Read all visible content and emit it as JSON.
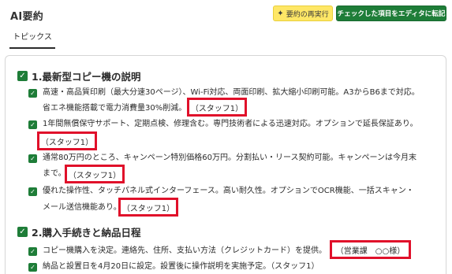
{
  "app": {
    "title": "AI要約"
  },
  "toolbar": {
    "rerun_label": "要約の再実行",
    "transfer_label": "チェックした項目をエディタに転記"
  },
  "tabs": [
    {
      "label": "トピックス"
    }
  ],
  "sections": [
    {
      "title": "1.最新型コピー機の説明",
      "items": [
        {
          "line1": "高速・高品質印刷（最大分速30ページ）、Wi-Fi対応、両面印刷、拡大縮小印刷可能。A3からB6まで対応。",
          "line2": "省エネ機能搭載で電力消費量30%削減。",
          "tag": "（スタッフ1）"
        },
        {
          "line1": "1年間無償保守サポート、定期点検、修理含む。専門技術者による迅速対応。オプションで延長保証あり。",
          "line2": "",
          "tag": "（スタッフ1）"
        },
        {
          "line1": "通常80万円のところ、キャンペーン特別価格60万円。分割払い・リース契約可能。キャンペーンは今月末",
          "line2": "まで。",
          "tag": "（スタッフ1）"
        },
        {
          "line1": "優れた操作性、タッチパネル式インターフェース。高い耐久性。オプションでOCR機能、一括スキャン・",
          "line2": "メール送信機能あり。",
          "tag": "（スタッフ1）"
        }
      ]
    },
    {
      "title": "2.購入手続きと納品日程",
      "items": [
        {
          "line1": "コピー機購入を決定。連絡先、住所、支払い方法（クレジットカード）を提供。",
          "tag": "（営業課　○○様）"
        },
        {
          "line1": "納品と設置日を4月20日に設定。設置後に操作説明を実施予定。（スタッフ1）",
          "tag": ""
        }
      ]
    }
  ],
  "icons": {
    "check": "check-icon",
    "wand": "magic-wand-icon"
  },
  "colors": {
    "primary_green": "#1e7d38",
    "highlight_yellow": "#ffe766",
    "annotation_red": "#e0102a"
  }
}
